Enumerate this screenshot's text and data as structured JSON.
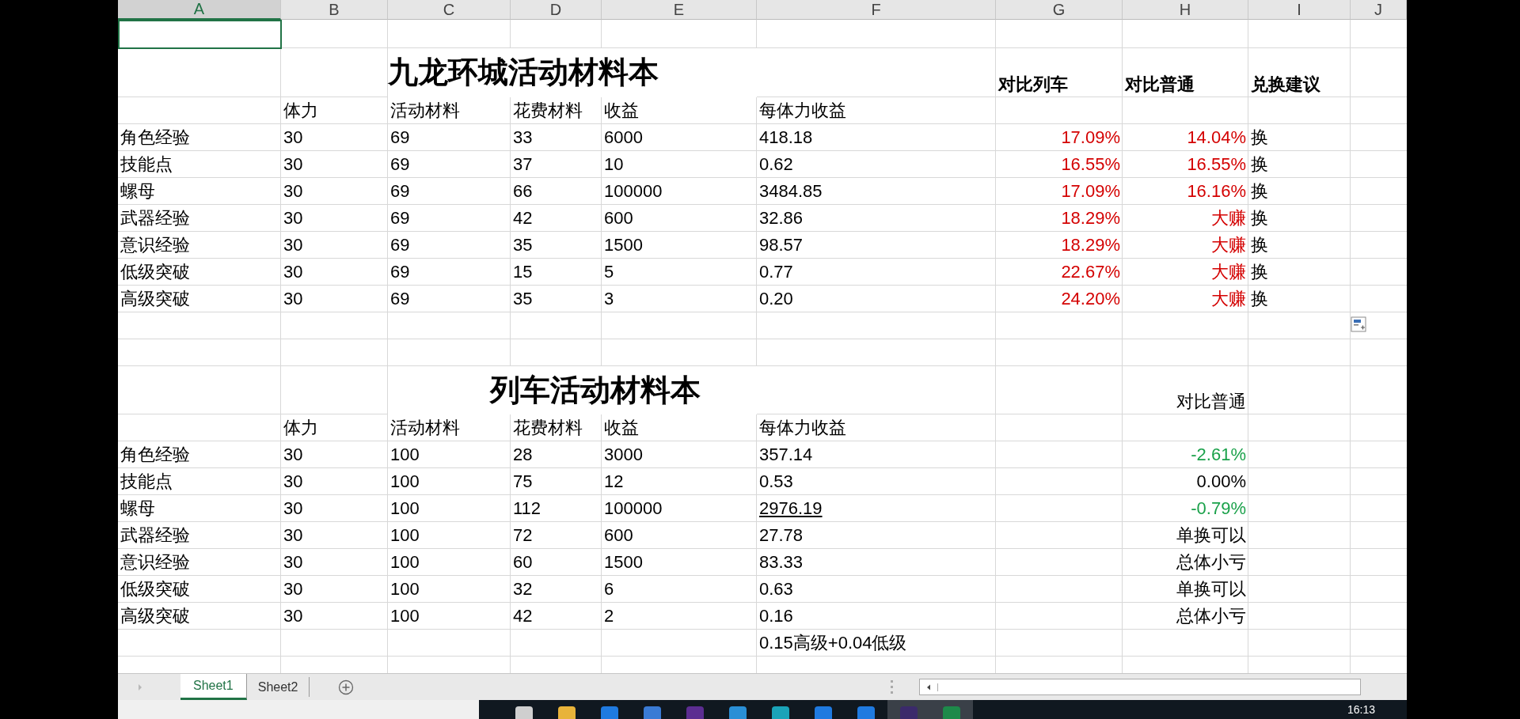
{
  "column_headers": [
    {
      "label": "A",
      "selected": true
    },
    {
      "label": "B",
      "selected": false
    },
    {
      "label": "C",
      "selected": false
    },
    {
      "label": "D",
      "selected": false
    },
    {
      "label": "E",
      "selected": false
    },
    {
      "label": "F",
      "selected": false
    },
    {
      "label": "G",
      "selected": false
    },
    {
      "label": "H",
      "selected": false
    },
    {
      "label": "I",
      "selected": false
    },
    {
      "label": "J",
      "selected": false
    }
  ],
  "sections": [
    {
      "title": "九龙环城活动材料本",
      "vs_train_header": "对比列车",
      "vs_normal_header": "对比普通",
      "advice_header": "兑换建议",
      "columns": [
        "体力",
        "活动材料",
        "花费材料",
        "收益",
        "每体力收益"
      ],
      "rows": [
        {
          "item": "角色经验",
          "stamina": "30",
          "event_material": "69",
          "cost": "33",
          "yield": "6000",
          "per_stamina": "418.18",
          "per_stamina_underlined": false,
          "vs_train": {
            "text": "17.09%",
            "color": "#d40000"
          },
          "vs_normal": {
            "text": "14.04%",
            "color": "#d40000"
          },
          "advice": "换"
        },
        {
          "item": "技能点",
          "stamina": "30",
          "event_material": "69",
          "cost": "37",
          "yield": "10",
          "per_stamina": "0.62",
          "per_stamina_underlined": false,
          "vs_train": {
            "text": "16.55%",
            "color": "#d40000"
          },
          "vs_normal": {
            "text": "16.55%",
            "color": "#d40000"
          },
          "advice": "换"
        },
        {
          "item": "螺母",
          "stamina": "30",
          "event_material": "69",
          "cost": "66",
          "yield": "100000",
          "per_stamina": "3484.85",
          "per_stamina_underlined": false,
          "vs_train": {
            "text": "17.09%",
            "color": "#d40000"
          },
          "vs_normal": {
            "text": "16.16%",
            "color": "#d40000"
          },
          "advice": "换"
        },
        {
          "item": "武器经验",
          "stamina": "30",
          "event_material": "69",
          "cost": "42",
          "yield": "600",
          "per_stamina": "32.86",
          "per_stamina_underlined": false,
          "vs_train": {
            "text": "18.29%",
            "color": "#d40000"
          },
          "vs_normal": {
            "text": "大赚",
            "color": "#d40000"
          },
          "advice": "换"
        },
        {
          "item": "意识经验",
          "stamina": "30",
          "event_material": "69",
          "cost": "35",
          "yield": "1500",
          "per_stamina": "98.57",
          "per_stamina_underlined": false,
          "vs_train": {
            "text": "18.29%",
            "color": "#d40000"
          },
          "vs_normal": {
            "text": "大赚",
            "color": "#d40000"
          },
          "advice": "换"
        },
        {
          "item": "低级突破",
          "stamina": "30",
          "event_material": "69",
          "cost": "15",
          "yield": "5",
          "per_stamina": "0.77",
          "per_stamina_underlined": false,
          "vs_train": {
            "text": "22.67%",
            "color": "#d40000"
          },
          "vs_normal": {
            "text": "大赚",
            "color": "#d40000"
          },
          "advice": "换"
        },
        {
          "item": "高级突破",
          "stamina": "30",
          "event_material": "69",
          "cost": "35",
          "yield": "3",
          "per_stamina": "0.20",
          "per_stamina_underlined": false,
          "vs_train": {
            "text": "24.20%",
            "color": "#d40000"
          },
          "vs_normal": {
            "text": "大赚",
            "color": "#d40000"
          },
          "advice": "换"
        }
      ]
    },
    {
      "title": "列车活动材料本",
      "vs_normal_header": "对比普通",
      "columns": [
        "体力",
        "活动材料",
        "花费材料",
        "收益",
        "每体力收益"
      ],
      "rows": [
        {
          "item": "角色经验",
          "stamina": "30",
          "event_material": "100",
          "cost": "28",
          "yield": "3000",
          "per_stamina": "357.14",
          "per_stamina_underlined": false,
          "vs_normal": {
            "text": "-2.61%",
            "color": "#1aa14a"
          }
        },
        {
          "item": "技能点",
          "stamina": "30",
          "event_material": "100",
          "cost": "75",
          "yield": "12",
          "per_stamina": "0.53",
          "per_stamina_underlined": false,
          "vs_normal": {
            "text": "0.00%",
            "color": "#000000"
          }
        },
        {
          "item": "螺母",
          "stamina": "30",
          "event_material": "100",
          "cost": "112",
          "yield": "100000",
          "per_stamina": "2976.19",
          "per_stamina_underlined": true,
          "vs_normal": {
            "text": "-0.79%",
            "color": "#1aa14a"
          }
        },
        {
          "item": "武器经验",
          "stamina": "30",
          "event_material": "100",
          "cost": "72",
          "yield": "600",
          "per_stamina": "27.78",
          "per_stamina_underlined": false,
          "vs_normal": {
            "text": "单换可以",
            "color": "#000000"
          }
        },
        {
          "item": "意识经验",
          "stamina": "30",
          "event_material": "100",
          "cost": "60",
          "yield": "1500",
          "per_stamina": "83.33",
          "per_stamina_underlined": false,
          "vs_normal": {
            "text": "总体小亏",
            "color": "#000000"
          }
        },
        {
          "item": "低级突破",
          "stamina": "30",
          "event_material": "100",
          "cost": "32",
          "yield": "6",
          "per_stamina": "0.63",
          "per_stamina_underlined": false,
          "vs_normal": {
            "text": "单换可以",
            "color": "#000000"
          }
        },
        {
          "item": "高级突破",
          "stamina": "30",
          "event_material": "100",
          "cost": "42",
          "yield": "2",
          "per_stamina": "0.16",
          "per_stamina_underlined": false,
          "vs_normal": {
            "text": "总体小亏",
            "color": "#000000"
          }
        }
      ],
      "note": "0.15高级+0.04低级"
    }
  ],
  "sheet_tabs": [
    {
      "label": "Sheet1",
      "selected": true
    },
    {
      "label": "Sheet2",
      "selected": false
    }
  ],
  "taskbar": {
    "time": "16:13"
  }
}
